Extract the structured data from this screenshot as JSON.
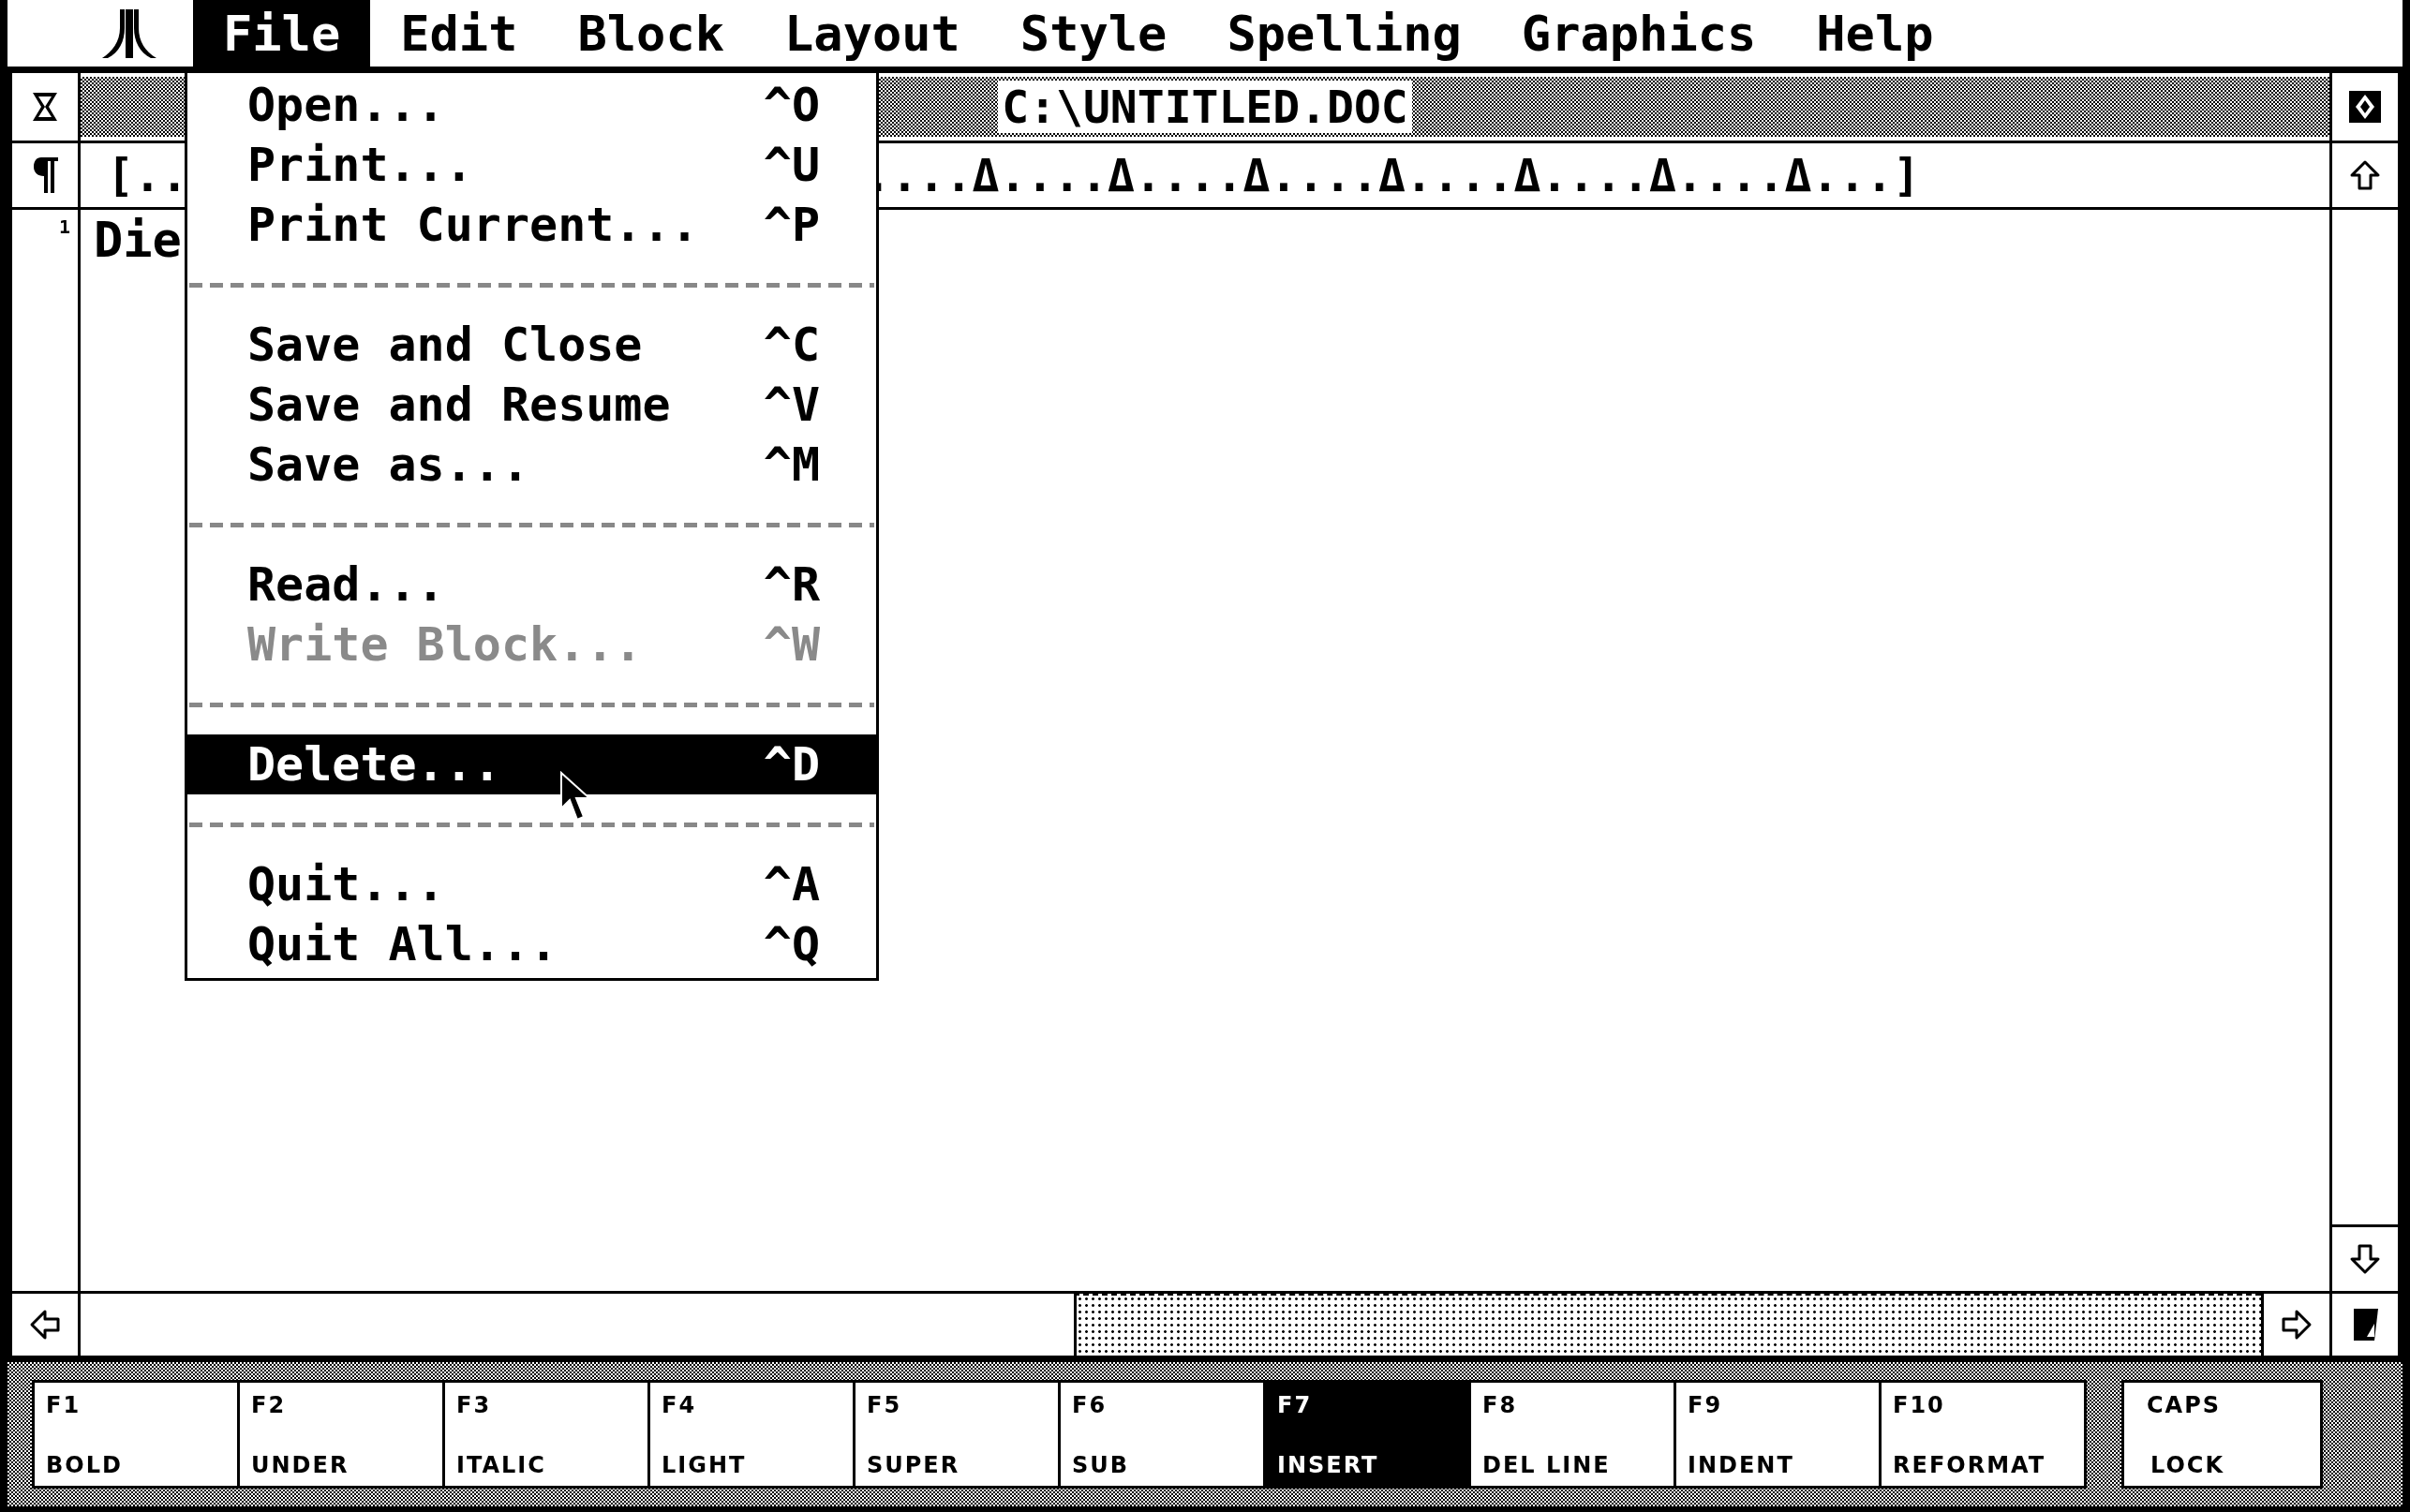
{
  "menu_bar": {
    "items": [
      {
        "label": "File",
        "selected": true
      },
      {
        "label": "Edit",
        "selected": false
      },
      {
        "label": "Block",
        "selected": false
      },
      {
        "label": "Layout",
        "selected": false
      },
      {
        "label": "Style",
        "selected": false
      },
      {
        "label": "Spelling",
        "selected": false
      },
      {
        "label": "Graphics",
        "selected": false
      },
      {
        "label": "Help",
        "selected": false
      }
    ]
  },
  "file_menu": {
    "items": [
      {
        "kind": "item",
        "label": "Open...",
        "shortcut": "^O",
        "disabled": false,
        "selected": false
      },
      {
        "kind": "item",
        "label": "Print...",
        "shortcut": "^U",
        "disabled": false,
        "selected": false
      },
      {
        "kind": "item",
        "label": "Print Current...",
        "shortcut": "^P",
        "disabled": false,
        "selected": false
      },
      {
        "kind": "separator"
      },
      {
        "kind": "item",
        "label": "Save and Close",
        "shortcut": "^C",
        "disabled": false,
        "selected": false
      },
      {
        "kind": "item",
        "label": "Save and Resume",
        "shortcut": "^V",
        "disabled": false,
        "selected": false
      },
      {
        "kind": "item",
        "label": "Save as...",
        "shortcut": "^M",
        "disabled": false,
        "selected": false
      },
      {
        "kind": "separator"
      },
      {
        "kind": "item",
        "label": "Read...",
        "shortcut": "^R",
        "disabled": false,
        "selected": false
      },
      {
        "kind": "item",
        "label": "Write Block...",
        "shortcut": "^W",
        "disabled": true,
        "selected": false
      },
      {
        "kind": "separator"
      },
      {
        "kind": "item",
        "label": "Delete...",
        "shortcut": "^D",
        "disabled": false,
        "selected": true
      },
      {
        "kind": "separator"
      },
      {
        "kind": "item",
        "label": "Quit...",
        "shortcut": "^A",
        "disabled": false,
        "selected": false
      },
      {
        "kind": "item",
        "label": "Quit All...",
        "shortcut": "^Q",
        "disabled": false,
        "selected": false
      }
    ]
  },
  "window": {
    "title": "C:\\UNTITLED.DOC"
  },
  "ruler": {
    "left": "[..",
    "right": "....Δ....Δ....Δ....Δ....Δ....Δ....Δ...]"
  },
  "document": {
    "line_number": "1",
    "text": "Die"
  },
  "function_keys": [
    {
      "key": "F1",
      "label": "BOLD",
      "selected": false
    },
    {
      "key": "F2",
      "label": "UNDER",
      "selected": false
    },
    {
      "key": "F3",
      "label": "ITALIC",
      "selected": false
    },
    {
      "key": "F4",
      "label": "LIGHT",
      "selected": false
    },
    {
      "key": "F5",
      "label": "SUPER",
      "selected": false
    },
    {
      "key": "F6",
      "label": "SUB",
      "selected": false
    },
    {
      "key": "F7",
      "label": "INSERT",
      "selected": true
    },
    {
      "key": "F8",
      "label": "DEL LINE",
      "selected": false
    },
    {
      "key": "F9",
      "label": "INDENT",
      "selected": false
    },
    {
      "key": "F10",
      "label": "REFORMAT",
      "selected": false
    }
  ],
  "caps_key": {
    "top": "CAPS",
    "bottom": "LOCK"
  }
}
